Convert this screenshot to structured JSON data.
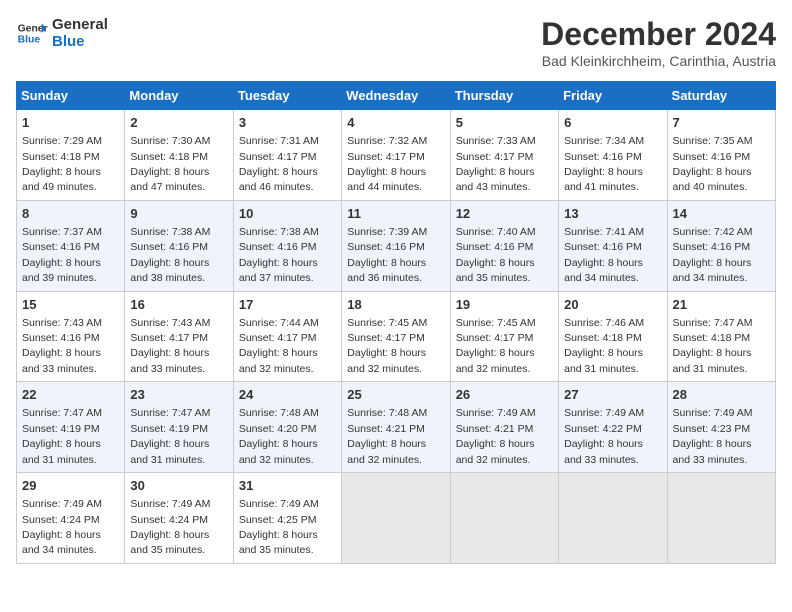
{
  "header": {
    "logo_general": "General",
    "logo_blue": "Blue",
    "month_year": "December 2024",
    "location": "Bad Kleinkirchheim, Carinthia, Austria"
  },
  "days_of_week": [
    "Sunday",
    "Monday",
    "Tuesday",
    "Wednesday",
    "Thursday",
    "Friday",
    "Saturday"
  ],
  "weeks": [
    [
      {
        "day": 1,
        "sunrise": "7:29 AM",
        "sunset": "4:18 PM",
        "daylight": "8 hours and 49 minutes."
      },
      {
        "day": 2,
        "sunrise": "7:30 AM",
        "sunset": "4:18 PM",
        "daylight": "8 hours and 47 minutes."
      },
      {
        "day": 3,
        "sunrise": "7:31 AM",
        "sunset": "4:17 PM",
        "daylight": "8 hours and 46 minutes."
      },
      {
        "day": 4,
        "sunrise": "7:32 AM",
        "sunset": "4:17 PM",
        "daylight": "8 hours and 44 minutes."
      },
      {
        "day": 5,
        "sunrise": "7:33 AM",
        "sunset": "4:17 PM",
        "daylight": "8 hours and 43 minutes."
      },
      {
        "day": 6,
        "sunrise": "7:34 AM",
        "sunset": "4:16 PM",
        "daylight": "8 hours and 41 minutes."
      },
      {
        "day": 7,
        "sunrise": "7:35 AM",
        "sunset": "4:16 PM",
        "daylight": "8 hours and 40 minutes."
      }
    ],
    [
      {
        "day": 8,
        "sunrise": "7:37 AM",
        "sunset": "4:16 PM",
        "daylight": "8 hours and 39 minutes."
      },
      {
        "day": 9,
        "sunrise": "7:38 AM",
        "sunset": "4:16 PM",
        "daylight": "8 hours and 38 minutes."
      },
      {
        "day": 10,
        "sunrise": "7:38 AM",
        "sunset": "4:16 PM",
        "daylight": "8 hours and 37 minutes."
      },
      {
        "day": 11,
        "sunrise": "7:39 AM",
        "sunset": "4:16 PM",
        "daylight": "8 hours and 36 minutes."
      },
      {
        "day": 12,
        "sunrise": "7:40 AM",
        "sunset": "4:16 PM",
        "daylight": "8 hours and 35 minutes."
      },
      {
        "day": 13,
        "sunrise": "7:41 AM",
        "sunset": "4:16 PM",
        "daylight": "8 hours and 34 minutes."
      },
      {
        "day": 14,
        "sunrise": "7:42 AM",
        "sunset": "4:16 PM",
        "daylight": "8 hours and 34 minutes."
      }
    ],
    [
      {
        "day": 15,
        "sunrise": "7:43 AM",
        "sunset": "4:16 PM",
        "daylight": "8 hours and 33 minutes."
      },
      {
        "day": 16,
        "sunrise": "7:43 AM",
        "sunset": "4:17 PM",
        "daylight": "8 hours and 33 minutes."
      },
      {
        "day": 17,
        "sunrise": "7:44 AM",
        "sunset": "4:17 PM",
        "daylight": "8 hours and 32 minutes."
      },
      {
        "day": 18,
        "sunrise": "7:45 AM",
        "sunset": "4:17 PM",
        "daylight": "8 hours and 32 minutes."
      },
      {
        "day": 19,
        "sunrise": "7:45 AM",
        "sunset": "4:17 PM",
        "daylight": "8 hours and 32 minutes."
      },
      {
        "day": 20,
        "sunrise": "7:46 AM",
        "sunset": "4:18 PM",
        "daylight": "8 hours and 31 minutes."
      },
      {
        "day": 21,
        "sunrise": "7:47 AM",
        "sunset": "4:18 PM",
        "daylight": "8 hours and 31 minutes."
      }
    ],
    [
      {
        "day": 22,
        "sunrise": "7:47 AM",
        "sunset": "4:19 PM",
        "daylight": "8 hours and 31 minutes."
      },
      {
        "day": 23,
        "sunrise": "7:47 AM",
        "sunset": "4:19 PM",
        "daylight": "8 hours and 31 minutes."
      },
      {
        "day": 24,
        "sunrise": "7:48 AM",
        "sunset": "4:20 PM",
        "daylight": "8 hours and 32 minutes."
      },
      {
        "day": 25,
        "sunrise": "7:48 AM",
        "sunset": "4:21 PM",
        "daylight": "8 hours and 32 minutes."
      },
      {
        "day": 26,
        "sunrise": "7:49 AM",
        "sunset": "4:21 PM",
        "daylight": "8 hours and 32 minutes."
      },
      {
        "day": 27,
        "sunrise": "7:49 AM",
        "sunset": "4:22 PM",
        "daylight": "8 hours and 33 minutes."
      },
      {
        "day": 28,
        "sunrise": "7:49 AM",
        "sunset": "4:23 PM",
        "daylight": "8 hours and 33 minutes."
      }
    ],
    [
      {
        "day": 29,
        "sunrise": "7:49 AM",
        "sunset": "4:24 PM",
        "daylight": "8 hours and 34 minutes."
      },
      {
        "day": 30,
        "sunrise": "7:49 AM",
        "sunset": "4:24 PM",
        "daylight": "8 hours and 35 minutes."
      },
      {
        "day": 31,
        "sunrise": "7:49 AM",
        "sunset": "4:25 PM",
        "daylight": "8 hours and 35 minutes."
      },
      null,
      null,
      null,
      null
    ]
  ]
}
